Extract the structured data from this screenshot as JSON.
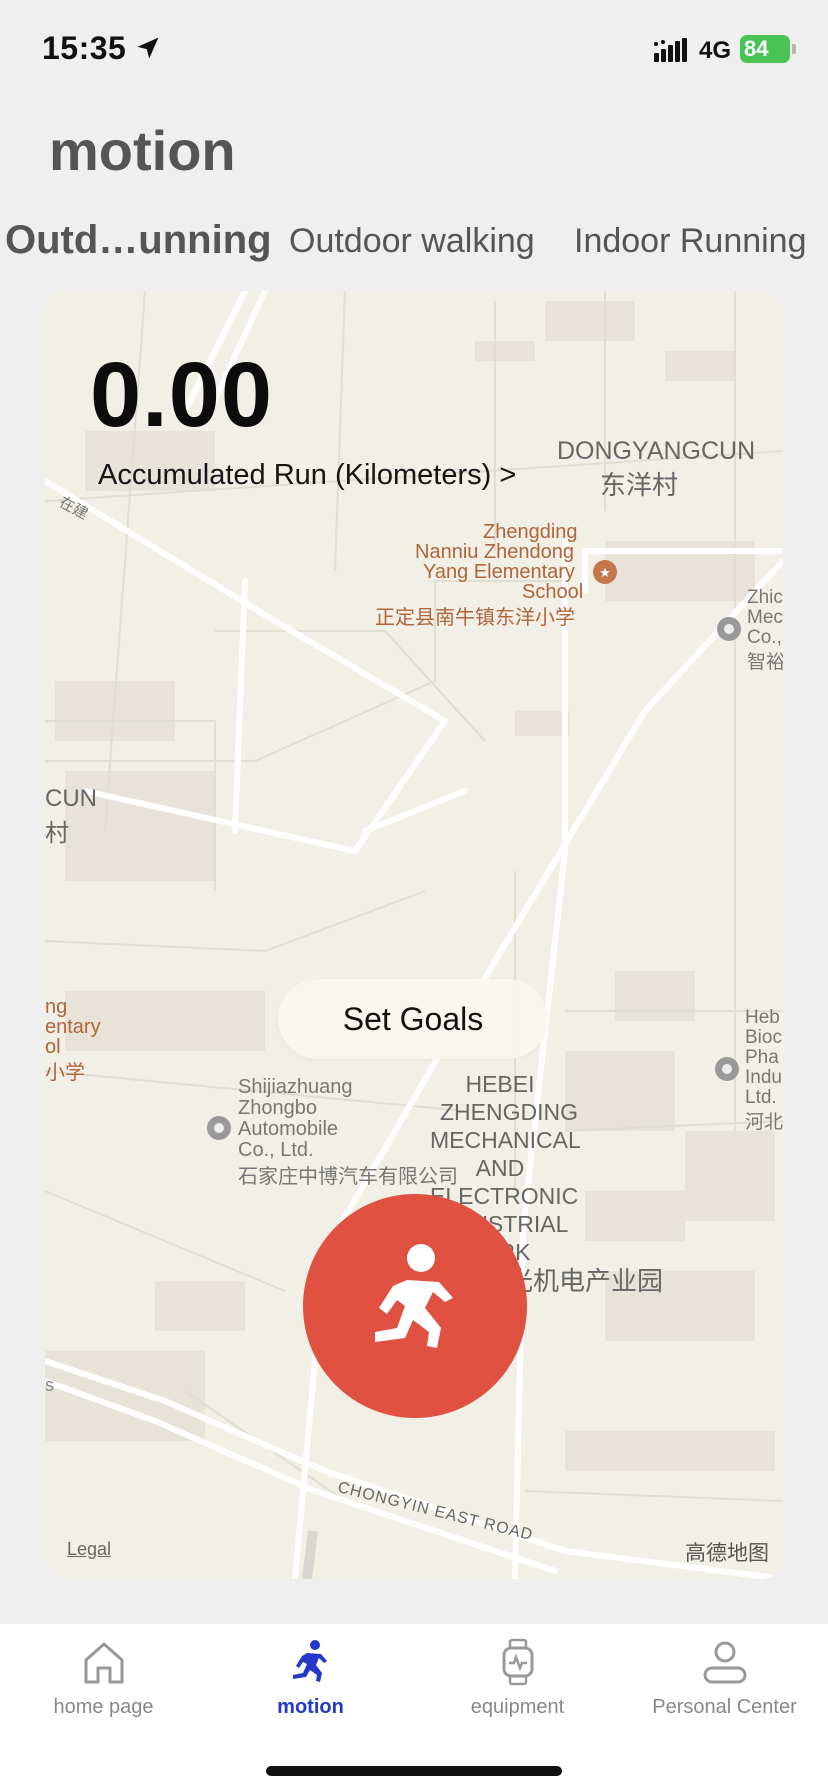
{
  "status_bar": {
    "time": "15:35",
    "network": "4G",
    "battery": "84",
    "icons": [
      "location-arrow-icon",
      "cellular-signal-icon",
      "battery-charging-icon"
    ]
  },
  "header": {
    "title": "motion"
  },
  "tabs": [
    {
      "label": "Outd…unning",
      "active": true
    },
    {
      "label": "Outdoor walking",
      "active": false
    },
    {
      "label": "Indoor Running",
      "active": false
    }
  ],
  "stats": {
    "value": "0.00",
    "label": "Accumulated Run (Kilometers) >"
  },
  "map": {
    "labels": {
      "dongyangcun_en": "DONGYANGCUN",
      "dongyangcun_cn": "东洋村",
      "road_zaijian": "在建",
      "school_en_1": "Zhengding",
      "school_en_2": "Nanniu Zhendong",
      "school_en_3": "Yang Elementary",
      "school_en_4": "School",
      "school_cn": "正定县南牛镇东洋小学",
      "poi_right_1": "Zhic",
      "poi_right_2": "Mec",
      "poi_right_3": "Co.,",
      "poi_right_4": "智裕",
      "cun_en": "CUN",
      "cun_cn": "村",
      "left_school_1": "ng",
      "left_school_2": "entary",
      "left_school_3": "ol",
      "left_school_4": "小学",
      "auto_1": "Shijiazhuang",
      "auto_2": "Zhongbo",
      "auto_3": "Automobile",
      "auto_4": "Co., Ltd.",
      "auto_cn": "石家庄中博汽车有限公司",
      "park_1": "HEBEI",
      "park_2": "ZHENGDING",
      "park_3": "MECHANICAL",
      "park_4": "AND",
      "park_5": "ELECTRONIC",
      "park_6": "INDUSTRIAL",
      "park_7": "PARK",
      "park_cn": "光机电产业园",
      "bio_1": "Heb",
      "bio_2": "Bioc",
      "bio_3": "Pha",
      "bio_4": "Indu",
      "bio_5": "Ltd.",
      "bio_6": "河北",
      "road_chongyin": "CHONGYIN EAST ROAD",
      "left_edge_s": "s"
    },
    "legal": "Legal",
    "provider": "高德地图"
  },
  "set_goals_label": "Set Goals",
  "start_button_icon": "running-person-icon",
  "tab_bar": [
    {
      "label": "home page",
      "icon": "home-icon",
      "active": false
    },
    {
      "label": "motion",
      "icon": "running-person-icon",
      "active": true
    },
    {
      "label": "equipment",
      "icon": "smartwatch-icon",
      "active": false
    },
    {
      "label": "Personal Center",
      "icon": "person-icon",
      "active": false
    }
  ],
  "colors": {
    "accent_red": "#e05142",
    "tab_active_blue": "#2438c9",
    "battery_green": "#49c454",
    "map_background": "#f2efe6",
    "poi_brown": "#b0653a"
  }
}
